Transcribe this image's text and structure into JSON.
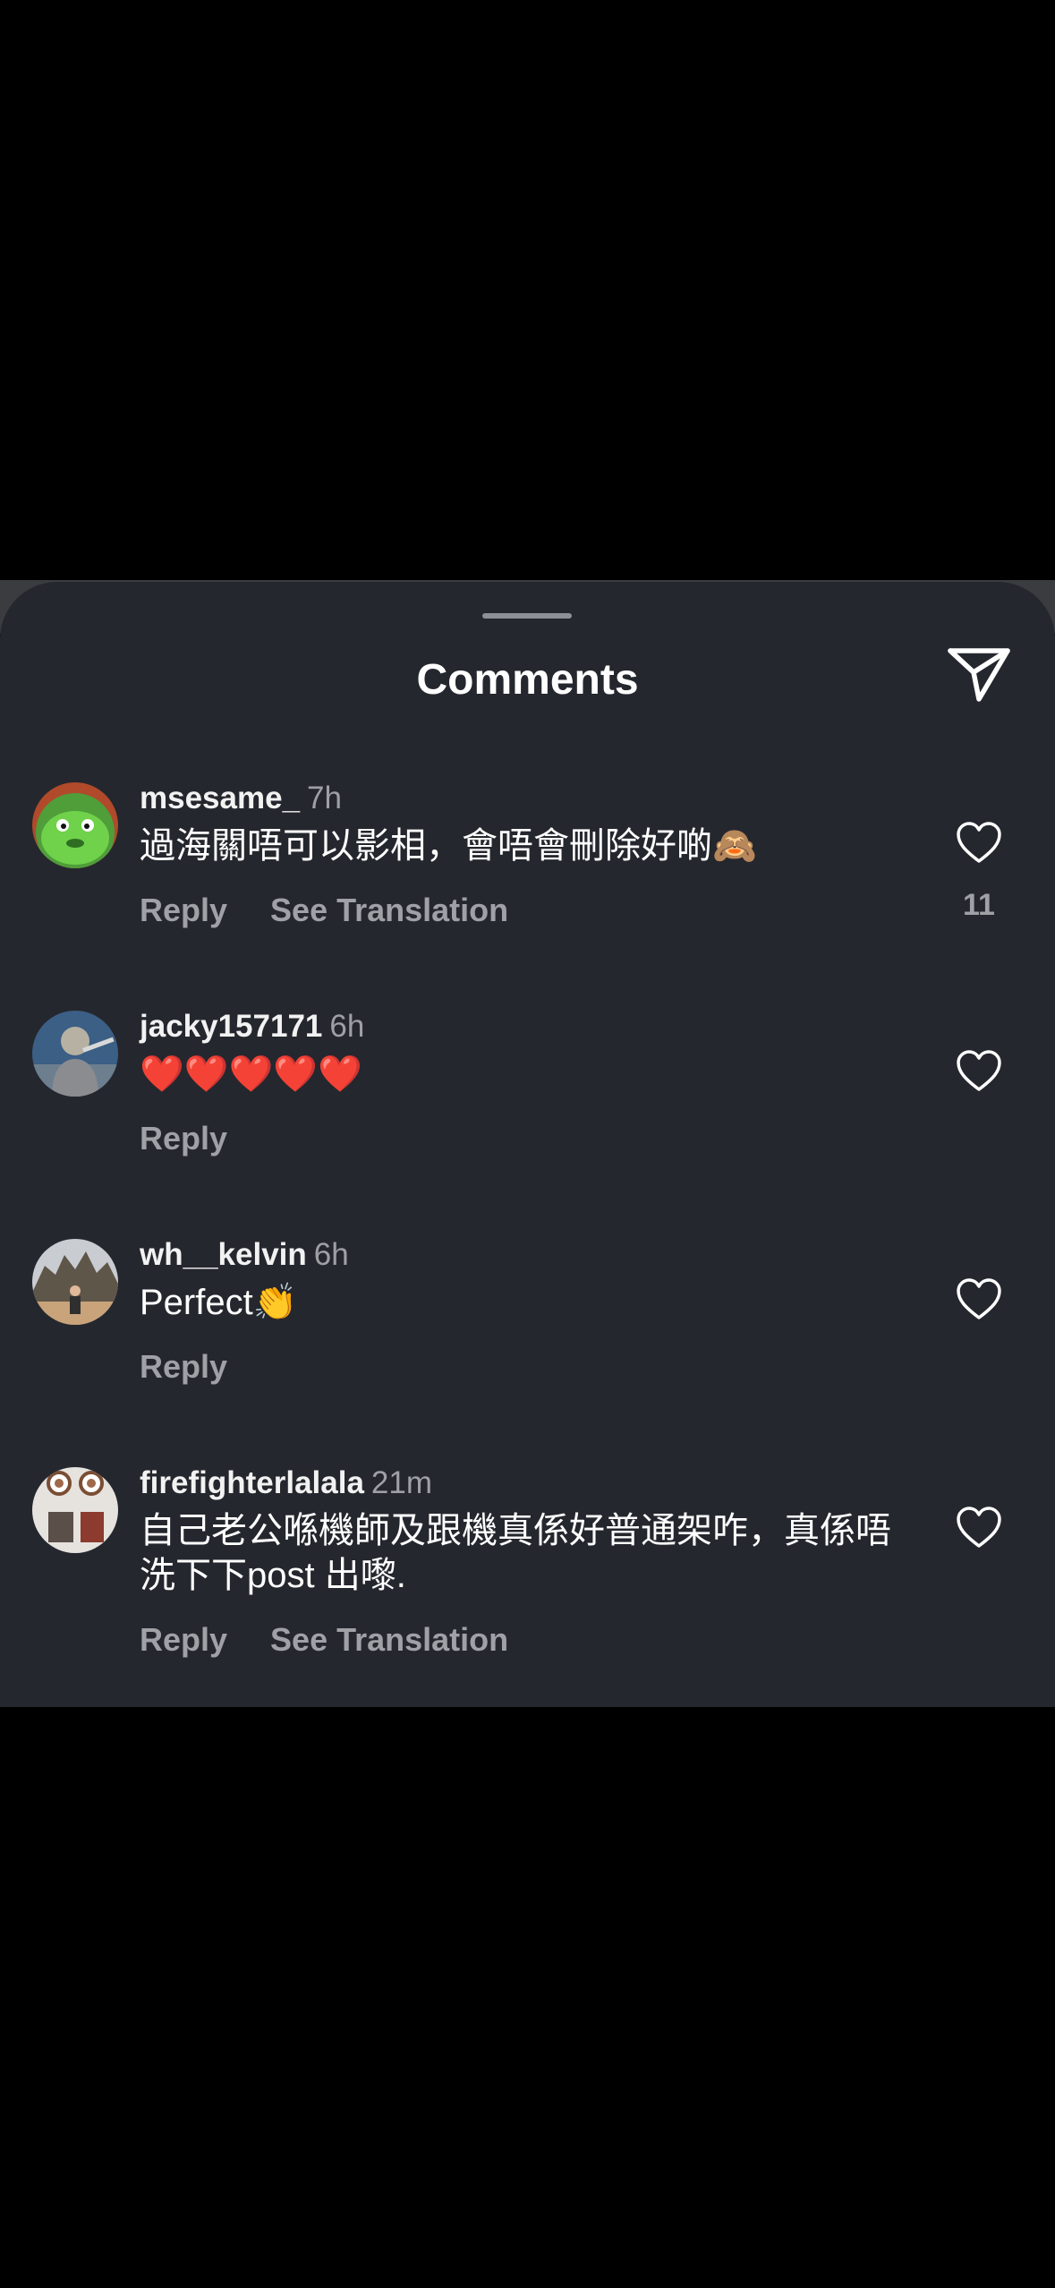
{
  "sheet": {
    "title": "Comments",
    "icons": {
      "share": "paper-plane-icon",
      "like": "heart-outline-icon"
    }
  },
  "comments": [
    {
      "username": "msesame_",
      "time": "7h",
      "text": "過海關唔可以影相，會唔會刪除好啲🙈",
      "actions": [
        "Reply",
        "See Translation"
      ],
      "likes": "11"
    },
    {
      "username": "jacky157171",
      "time": "6h",
      "text": "❤️❤️❤️❤️❤️",
      "actions": [
        "Reply"
      ]
    },
    {
      "username": "wh__kelvin",
      "time": "6h",
      "text": "Perfect👏",
      "actions": [
        "Reply"
      ]
    },
    {
      "username": "firefighterlalala",
      "time": "21m",
      "text": "自己老公喺機師及跟機真係好普通架咋，真係唔洗下下post 出嚟.",
      "actions": [
        "Reply",
        "See Translation"
      ]
    }
  ],
  "colors": {
    "background": "#000000",
    "sheet": "#25272e",
    "secondary_text": "#9fa1a7",
    "primary_text": "#ffffff"
  }
}
